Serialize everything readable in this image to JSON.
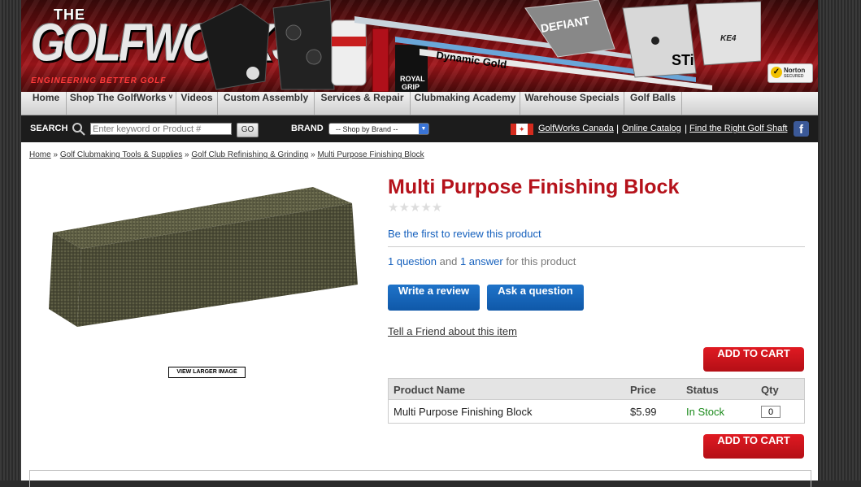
{
  "banner": {
    "logo_the": "THE",
    "logo_main": "GOLFWORKS",
    "logo_tagline": "ENGINEERING BETTER GOLF",
    "norton_text": "Norton",
    "norton_sub": "SECURED"
  },
  "nav": {
    "items": [
      {
        "label": "Home"
      },
      {
        "label": "Shop The GolfWorks ᵛ"
      },
      {
        "label": "Videos"
      },
      {
        "label": "Custom Assembly"
      },
      {
        "label": "Services & Repair"
      },
      {
        "label": "Clubmaking Academy"
      },
      {
        "label": "Warehouse Specials"
      },
      {
        "label": "Golf Balls"
      }
    ]
  },
  "search": {
    "label": "SEARCH",
    "placeholder": "Enter keyword or Product #",
    "go": "GO",
    "brand_label": "BRAND",
    "brand_select": "-- Shop by Brand --"
  },
  "toplinks": {
    "canada": "GolfWorks Canada",
    "catalog": "Online Catalog",
    "shaft": "Find the Right Golf Shaft",
    "fb": "f"
  },
  "breadcrumbs": [
    "Home",
    "Golf Clubmaking Tools & Supplies",
    "Golf Club Refinishing & Grinding",
    "Multi Purpose Finishing Block"
  ],
  "product": {
    "title": "Multi Purpose Finishing Block",
    "rating_stars": "★★★★★",
    "review_link": "Be the first to review this product",
    "qa_questions": "1 question",
    "qa_and": "and",
    "qa_answers": "1 answer",
    "qa_tail": "for this product",
    "write_review": "Write a review",
    "ask_question": "Ask a question",
    "tell_friend": "Tell a Friend about this item",
    "add_to_cart": "ADD TO CART",
    "view_larger": "VIEW LARGER IMAGE"
  },
  "table": {
    "headers": [
      "Product Name",
      "Price",
      "Status",
      "Qty"
    ],
    "rows": [
      {
        "name": "Multi Purpose Finishing Block",
        "price": "$5.99",
        "status": "In Stock",
        "qty": "0"
      }
    ]
  },
  "colors": {
    "title_red": "#b5121b",
    "link_blue": "#1560bd",
    "in_stock_green": "#1a8a1a",
    "button_red": "#d3141c"
  }
}
